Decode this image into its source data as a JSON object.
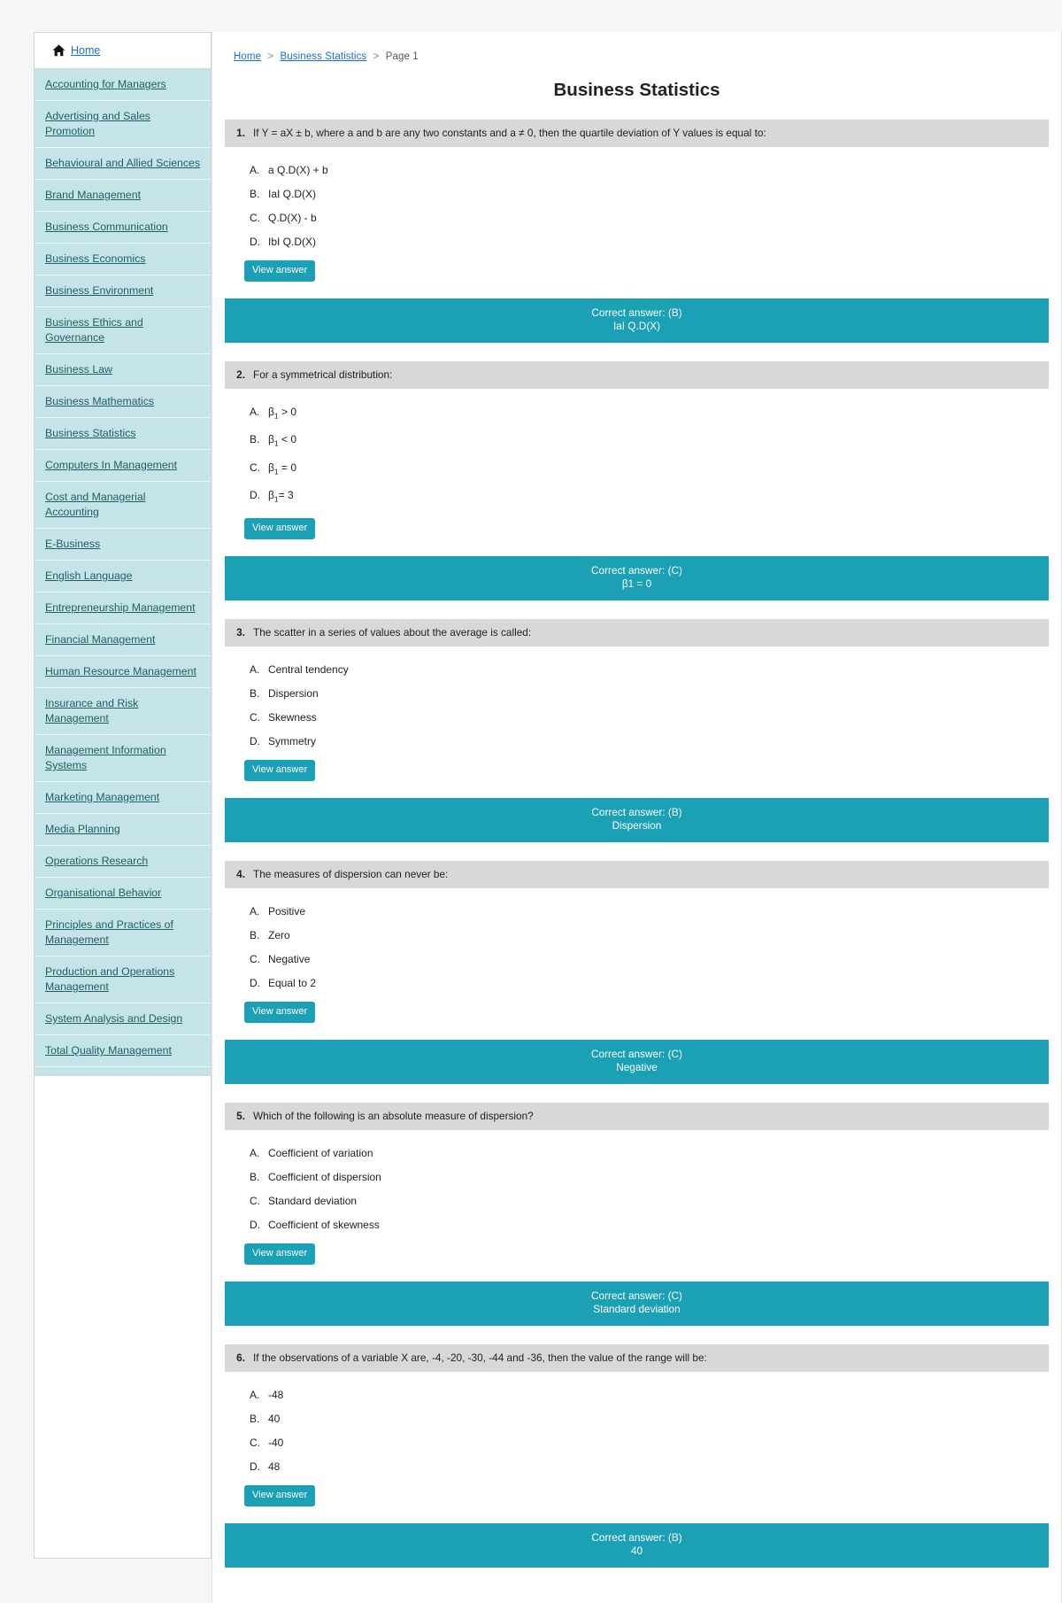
{
  "sidebar": {
    "home_label": "Home",
    "home_icon": "home-icon",
    "items": [
      {
        "label": "Accounting for Managers"
      },
      {
        "label": "Advertising and Sales Promotion"
      },
      {
        "label": "Behavioural and Allied Sciences"
      },
      {
        "label": "Brand Management"
      },
      {
        "label": "Business Communication"
      },
      {
        "label": "Business Economics"
      },
      {
        "label": "Business Environment"
      },
      {
        "label": "Business Ethics and Governance"
      },
      {
        "label": "Business Law"
      },
      {
        "label": "Business Mathematics"
      },
      {
        "label": "Business Statistics"
      },
      {
        "label": "Computers In Management"
      },
      {
        "label": "Cost and Managerial Accounting"
      },
      {
        "label": "E-Business"
      },
      {
        "label": "English Language"
      },
      {
        "label": "Entrepreneurship Management"
      },
      {
        "label": "Financial Management"
      },
      {
        "label": "Human Resource Management"
      },
      {
        "label": "Insurance and Risk Management"
      },
      {
        "label": "Management Information Systems"
      },
      {
        "label": "Marketing Management"
      },
      {
        "label": "Media Planning"
      },
      {
        "label": "Operations Research"
      },
      {
        "label": "Organisational Behavior"
      },
      {
        "label": "Principles and Practices of Management"
      },
      {
        "label": "Production and Operations Management"
      },
      {
        "label": "System Analysis and Design"
      },
      {
        "label": "Total Quality Management"
      }
    ]
  },
  "breadcrumb": {
    "home": "Home",
    "section": "Business Statistics",
    "current": "Page 1",
    "separator": ">"
  },
  "header": {
    "title": "Business Statistics"
  },
  "colors": {
    "accent": "#1ba0b5",
    "sidebar_item_bg": "#c5e4e7",
    "question_header_bg": "#d8d8d8",
    "link": "#1a6fd4",
    "sidebar_link": "#1f5f66"
  },
  "buttons": {
    "view_answer": "View answer"
  },
  "questions": [
    {
      "number": "1.",
      "text": "If Y = aX ± b, where a and b are any two constants and a ≠ 0, then the quartile deviation of Y values is equal to:",
      "options": [
        {
          "label": "A.",
          "text": "a Q.D(X) + b"
        },
        {
          "label": "B.",
          "text": "IaI Q.D(X)"
        },
        {
          "label": "C.",
          "text": "Q.D(X) - b"
        },
        {
          "label": "D.",
          "text": "IbI Q.D(X)"
        }
      ],
      "answer_label": "Correct answer: (B)",
      "answer_text": "IaI Q.D(X)"
    },
    {
      "number": "2.",
      "text": "For a symmetrical distribution:",
      "options": [
        {
          "label": "A.",
          "text": "β",
          "sub": "1",
          "tail": " > 0"
        },
        {
          "label": "B.",
          "text": "β",
          "sub": "1",
          "tail": " < 0"
        },
        {
          "label": "C.",
          "text": "β",
          "sub": "1",
          "tail": " = 0"
        },
        {
          "label": "D.",
          "text": "β",
          "sub": "1",
          "tail": "= 3"
        }
      ],
      "answer_label": "Correct answer: (C)",
      "answer_text": "β1 = 0"
    },
    {
      "number": "3.",
      "text": "The scatter in a series of values about the average is called:",
      "options": [
        {
          "label": "A.",
          "text": "Central tendency"
        },
        {
          "label": "B.",
          "text": "Dispersion"
        },
        {
          "label": "C.",
          "text": "Skewness"
        },
        {
          "label": "D.",
          "text": "Symmetry"
        }
      ],
      "answer_label": "Correct answer: (B)",
      "answer_text": "Dispersion"
    },
    {
      "number": "4.",
      "text": "The measures of dispersion can never be:",
      "options": [
        {
          "label": "A.",
          "text": "Positive"
        },
        {
          "label": "B.",
          "text": "Zero"
        },
        {
          "label": "C.",
          "text": "Negative"
        },
        {
          "label": "D.",
          "text": "Equal to 2"
        }
      ],
      "answer_label": "Correct answer: (C)",
      "answer_text": "Negative"
    },
    {
      "number": "5.",
      "text": "Which of the following is an absolute measure of dispersion?",
      "options": [
        {
          "label": "A.",
          "text": "Coefficient of variation"
        },
        {
          "label": "B.",
          "text": "Coefficient of dispersion"
        },
        {
          "label": "C.",
          "text": "Standard deviation"
        },
        {
          "label": "D.",
          "text": "Coefficient of skewness"
        }
      ],
      "answer_label": "Correct answer: (C)",
      "answer_text": "Standard deviation"
    },
    {
      "number": "6.",
      "text": "If the observations of a variable X are, -4, -20, -30, -44 and -36, then the value of the range will be:",
      "options": [
        {
          "label": "A.",
          "text": "-48"
        },
        {
          "label": "B.",
          "text": "40"
        },
        {
          "label": "C.",
          "text": "-40"
        },
        {
          "label": "D.",
          "text": "48"
        }
      ],
      "answer_label": "Correct answer: (B)",
      "answer_text": "40"
    }
  ]
}
